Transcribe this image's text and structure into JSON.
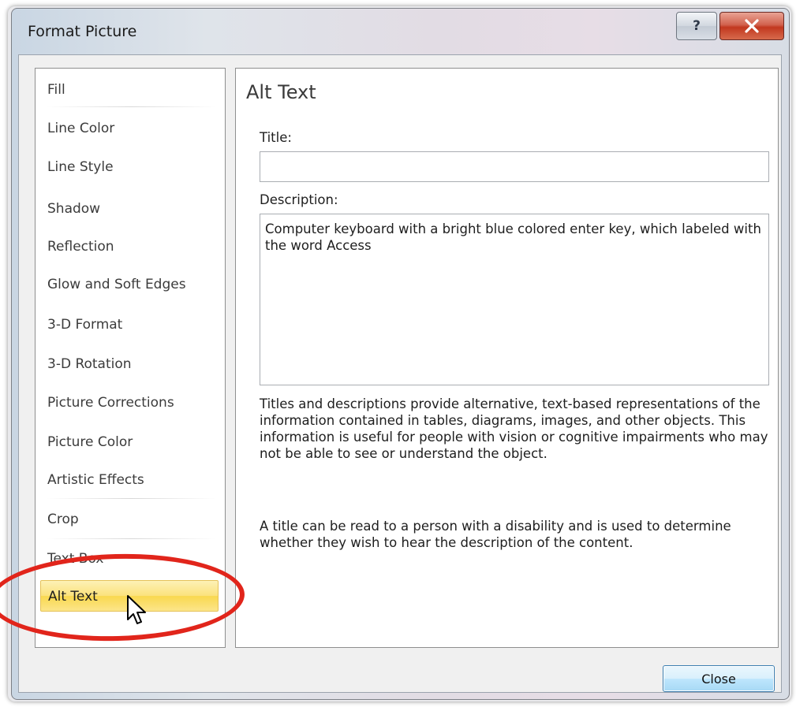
{
  "window": {
    "title": "Format Picture",
    "help_glyph": "?",
    "close_glyph": "x"
  },
  "sidebar": {
    "items": [
      {
        "label": "Fill"
      },
      {
        "label": "Line Color"
      },
      {
        "label": "Line Style"
      },
      {
        "label": "Shadow"
      },
      {
        "label": "Reflection"
      },
      {
        "label": "Glow and Soft Edges"
      },
      {
        "label": "3-D Format"
      },
      {
        "label": "3-D Rotation"
      },
      {
        "label": "Picture Corrections"
      },
      {
        "label": "Picture Color"
      },
      {
        "label": "Artistic Effects"
      },
      {
        "label": "Crop"
      },
      {
        "label": "Text Box"
      },
      {
        "label": "Alt Text",
        "selected": true
      }
    ]
  },
  "panel": {
    "heading": "Alt Text",
    "title_label": "Title:",
    "title_value": "",
    "description_label": "Description:",
    "description_value": "Computer keyboard with a bright blue colored enter key, which labeled with the word Access",
    "help_paragraph_1": "Titles and descriptions provide alternative, text-based representations of the information contained in tables, diagrams, images, and other objects. This information is useful for people with vision or cognitive impairments who may not be able to see or understand the object.",
    "help_paragraph_2": "A title can be read to a person with a disability and is used to determine whether they wish to hear the description of the content."
  },
  "footer": {
    "close_label": "Close"
  },
  "annotation": {
    "highlight_color": "#e1251b",
    "cursor_icon": "arrow-pointer-icon"
  }
}
